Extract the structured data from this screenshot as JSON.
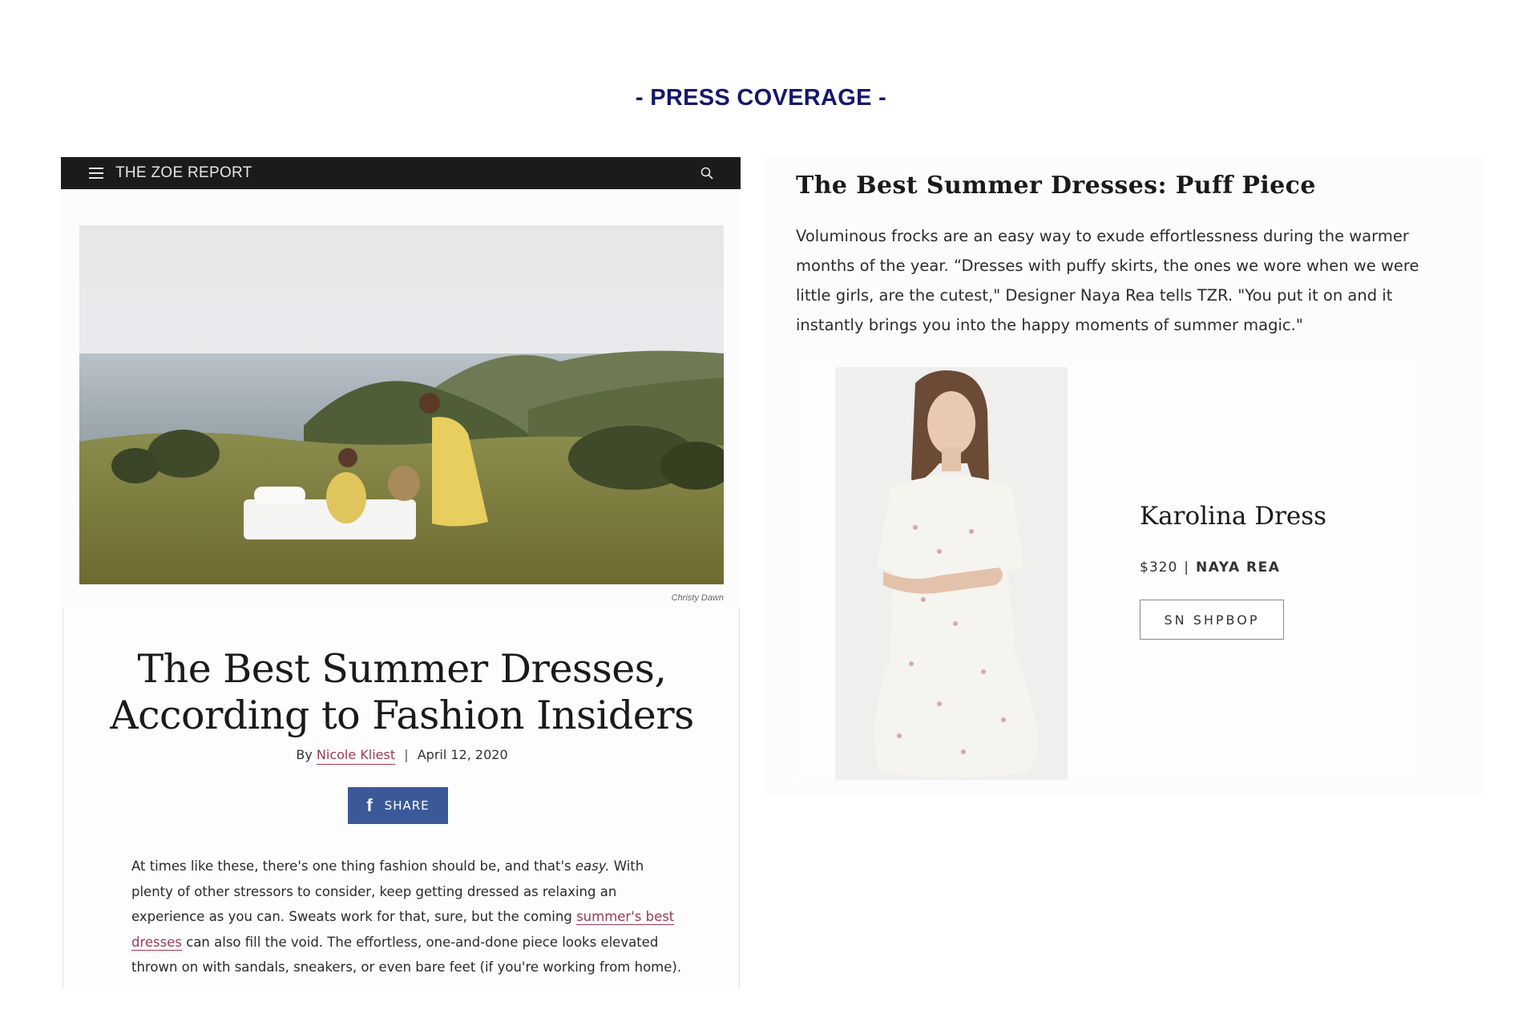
{
  "page": {
    "heading": "- PRESS COVERAGE -",
    "heading_color": "#16186b"
  },
  "zoe_report": {
    "topbar": {
      "menu_icon": "hamburger-menu-icon",
      "brand": "THE ZOE REPORT",
      "search_icon": "search-icon",
      "bar_color": "#1b1b1b"
    },
    "hero": {
      "image": "women-in-summer-dresses-on-hillside-photo",
      "credit": "Christy Dawn"
    },
    "article": {
      "title_line1": "The Best Summer Dresses,",
      "title_line2": "According to Fashion Insiders",
      "by": "By",
      "author": "Nicole Kliest",
      "separator": "|",
      "date": "April 12, 2020",
      "share_icon": "facebook-icon",
      "share_label": "SHARE",
      "share_color": "#3b5998",
      "intro_part1": "At times like these, there's one thing fashion should be, and that's ",
      "intro_emphasis": "easy.",
      "intro_part2": " With plenty of other stressors to consider, keep getting dressed as relaxing an experience as you can. Sweats work for that, sure, but the coming ",
      "intro_link": "summer's best dresses",
      "intro_part3": " can also fill the void. The effortless, one-and-done piece looks elevated thrown on with sandals, sneakers, or even bare feet (if you're working from home).",
      "link_color": "#9b3a55"
    }
  },
  "puff_piece": {
    "title": "The Best Summer Dresses: Puff Piece",
    "paragraph": "Voluminous frocks are an easy way to exude effortlessness during the warmer months of the year. “Dresses with puffy skirts, the ones we wore when we were little girls, are the cutest,\" Designer Naya Rea tells TZR. \"You put it on and it instantly brings you into the happy moments of summer magic.\"",
    "product": {
      "image": "model-in-white-floral-dress-photo",
      "name": "Karolina Dress",
      "price": "$320",
      "separator": "|",
      "brand": "NAYA REA",
      "shop_label": "SN SHPBOP"
    }
  }
}
